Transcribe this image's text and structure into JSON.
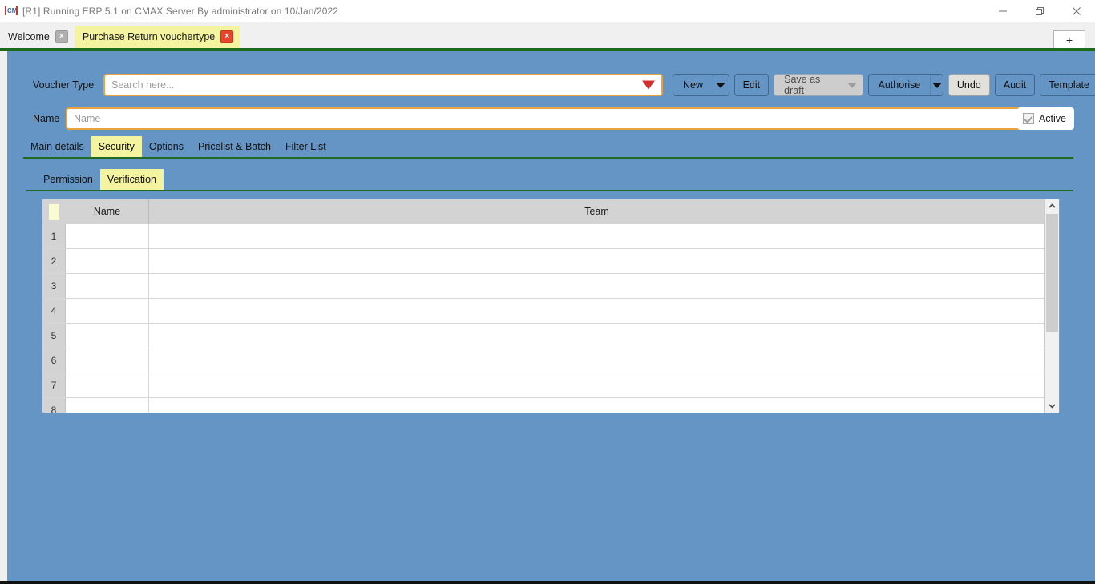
{
  "window": {
    "title": "[R1] Running ERP 5.1 on CMAX Server By administrator on 10/Jan/2022",
    "app_icon": "cmx-logo-icon",
    "controls": {
      "minimize": "minimize-icon",
      "restore": "restore-icon",
      "close": "close-icon"
    }
  },
  "tabs": {
    "items": [
      {
        "label": "Welcome",
        "active": false,
        "close": "×"
      },
      {
        "label": "Purchase Return vouchertype",
        "active": true,
        "close": "×"
      }
    ],
    "new_tab_label": "+"
  },
  "form": {
    "voucher_type": {
      "label": "Voucher Type",
      "value": "",
      "placeholder": "Search here...",
      "dropdown_icon": "dropdown-triangle-icon",
      "dropdown_color": "#d32f2f"
    },
    "name": {
      "label": "Name",
      "value": "",
      "placeholder": "Name"
    },
    "active": {
      "label": "Active",
      "checked": true,
      "disabled": true
    }
  },
  "toolbar": {
    "new": {
      "label": "New",
      "type": "split",
      "disabled": false
    },
    "edit": {
      "label": "Edit",
      "type": "button",
      "disabled": false
    },
    "save_as_draft": {
      "label": "Save as draft",
      "type": "split",
      "disabled": true
    },
    "authorise": {
      "label": "Authorise",
      "type": "split",
      "disabled": false
    },
    "undo": {
      "label": "Undo",
      "type": "button",
      "hover": true
    },
    "audit": {
      "label": "Audit",
      "type": "button"
    },
    "template": {
      "label": "Template",
      "type": "button"
    }
  },
  "main_tabs": [
    {
      "label": "Main details",
      "active": false
    },
    {
      "label": "Security",
      "active": true
    },
    {
      "label": "Options",
      "active": false
    },
    {
      "label": "Pricelist & Batch",
      "active": false
    },
    {
      "label": "Filter List",
      "active": false
    }
  ],
  "sub_tabs": [
    {
      "label": "Permission",
      "active": false
    },
    {
      "label": "Verification",
      "active": true
    }
  ],
  "grid": {
    "columns": [
      {
        "key": "selector",
        "label": ""
      },
      {
        "key": "name",
        "label": "Name"
      },
      {
        "key": "team",
        "label": "Team"
      }
    ],
    "rows": [
      {
        "index": "1",
        "name": "",
        "team": ""
      },
      {
        "index": "2",
        "name": "",
        "team": ""
      },
      {
        "index": "3",
        "name": "",
        "team": ""
      },
      {
        "index": "4",
        "name": "",
        "team": ""
      },
      {
        "index": "5",
        "name": "",
        "team": ""
      },
      {
        "index": "6",
        "name": "",
        "team": ""
      },
      {
        "index": "7",
        "name": "",
        "team": ""
      },
      {
        "index": "8",
        "name": "",
        "team": ""
      }
    ],
    "scrollbar": {
      "up_icon": "chevron-up-icon",
      "down_icon": "chevron-down-icon"
    }
  },
  "theme": {
    "page_background": "#6595c4",
    "accent_green": "#1e6b1e",
    "active_tab_yellow": "#f4f4a0",
    "field_focus_border": "#e8a33d",
    "grid_header": "#d3d3d3"
  }
}
